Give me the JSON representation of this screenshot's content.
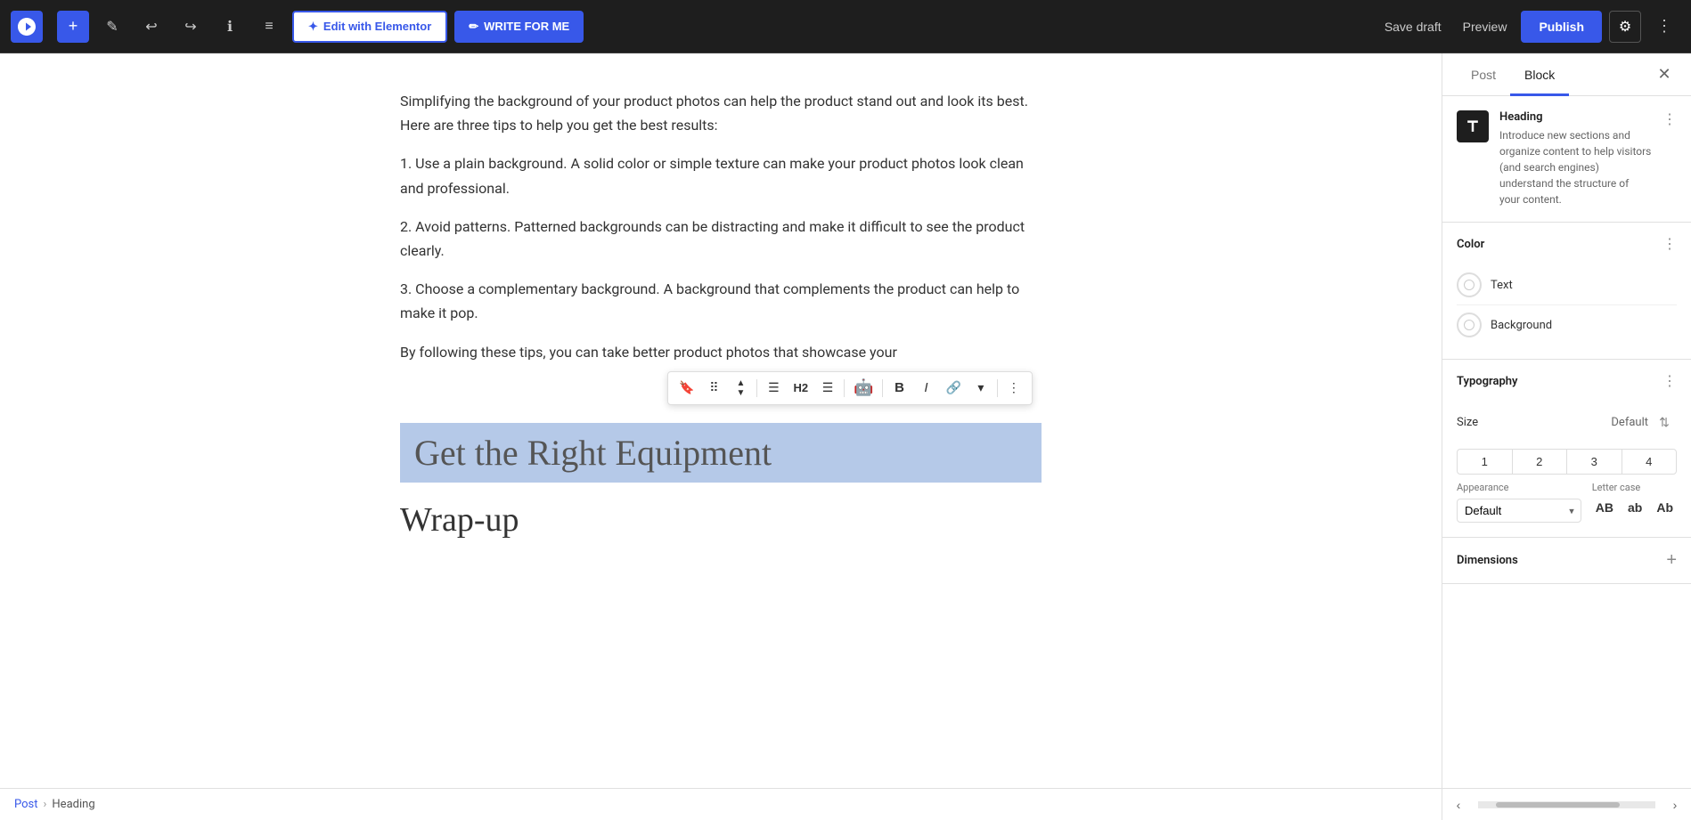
{
  "topbar": {
    "wp_logo_title": "WordPress",
    "add_label": "+",
    "tools_label": "✎",
    "undo_label": "↩",
    "redo_label": "↪",
    "info_label": "ℹ",
    "list_label": "≡",
    "elementor_label": "Edit with Elementor",
    "write_label": "WRITE FOR ME",
    "save_draft_label": "Save draft",
    "preview_label": "Preview",
    "publish_label": "Publish",
    "settings_label": "⚙",
    "more_label": "⋮"
  },
  "editor": {
    "paragraph1": "Simplifying the background of your product photos can help the product stand out and look its best. Here are three tips to help you get the best results:",
    "paragraph2": "1. Use a plain background. A solid color or simple texture can make your product photos look clean and professional.",
    "paragraph3": "2. Avoid patterns. Patterned backgrounds can be distracting and make it difficult to see the product clearly.",
    "paragraph4": "3. Choose a complementary background. A background that complements the product can help to make it pop.",
    "paragraph5": "By following these tips, you can take better product photos that showcase your",
    "heading_highlighted": "Get the Right Equipment",
    "heading_wrapup": "Wrap-up"
  },
  "toolbar": {
    "bookmark_label": "🔖",
    "drag_label": "⠿",
    "move_up_label": "▲",
    "move_down_label": "▼",
    "align_label": "☰",
    "h2_label": "H2",
    "align2_label": "☰",
    "emoji_label": "🤖",
    "bold_label": "B",
    "italic_label": "I",
    "link_label": "🔗",
    "more_options_label": "⋮",
    "dropdown_label": "▾"
  },
  "sidebar": {
    "tab_post_label": "Post",
    "tab_block_label": "Block",
    "close_label": "✕",
    "block_title": "Heading",
    "block_description": "Introduce new sections and organize content to help visitors (and search engines) understand the structure of your content.",
    "more_options_label": "⋮",
    "color_section_label": "Color",
    "text_color_label": "Text",
    "background_color_label": "Background",
    "typography_section_label": "Typography",
    "size_label": "Size",
    "size_value_label": "Default",
    "size_buttons": [
      "1",
      "2",
      "3",
      "4"
    ],
    "appearance_section_label": "Appearance",
    "appearance_field_label": "Appearance",
    "letter_case_label": "Letter case",
    "appearance_default": "Default",
    "letter_case_AB": "AB",
    "letter_case_ab": "ab",
    "letter_case_Ab": "Ab",
    "dimensions_label": "Dimensions",
    "add_dimension_label": "+"
  },
  "breadcrumb": {
    "post_label": "Post",
    "separator": "›",
    "heading_label": "Heading"
  }
}
